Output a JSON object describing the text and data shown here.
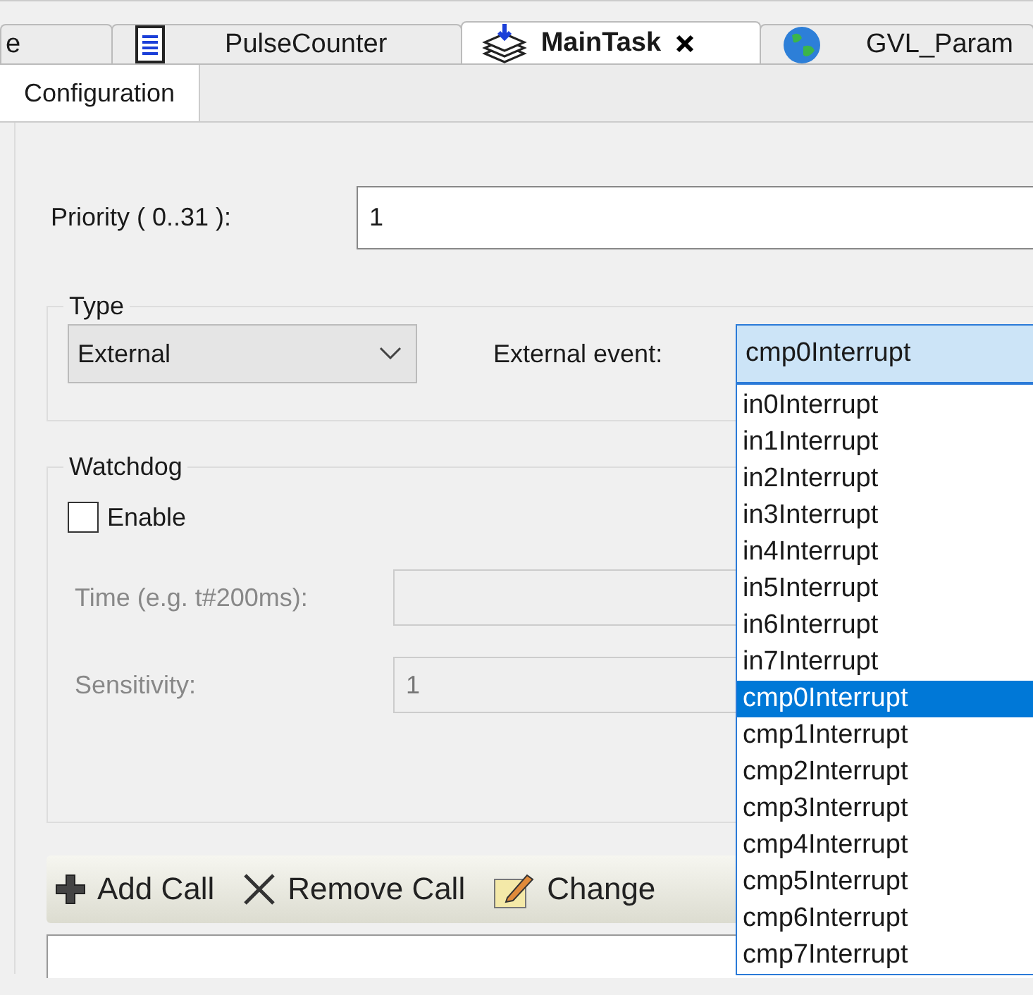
{
  "document_tabs": [
    {
      "label": "e",
      "kind": "plain",
      "selected": false
    },
    {
      "label": "PulseCounter",
      "kind": "document",
      "selected": false
    },
    {
      "label": "MainTask",
      "kind": "task",
      "selected": true
    },
    {
      "label": "GVL_Param",
      "kind": "globe",
      "selected": false
    }
  ],
  "editor_tabs": [
    {
      "label": "Configuration",
      "selected": true
    }
  ],
  "priority": {
    "label": "Priority ( 0..31 ):",
    "value": "1"
  },
  "type_group": {
    "title": "Type",
    "type_select": {
      "value": "External"
    },
    "event_label": "External event:",
    "event_select": {
      "value": "cmp0Interrupt",
      "expanded": true,
      "options": [
        {
          "label": "in0Interrupt",
          "selected": false
        },
        {
          "label": "in1Interrupt",
          "selected": false
        },
        {
          "label": "in2Interrupt",
          "selected": false
        },
        {
          "label": "in3Interrupt",
          "selected": false
        },
        {
          "label": "in4Interrupt",
          "selected": false
        },
        {
          "label": "in5Interrupt",
          "selected": false
        },
        {
          "label": "in6Interrupt",
          "selected": false
        },
        {
          "label": "in7Interrupt",
          "selected": false
        },
        {
          "label": "cmp0Interrupt",
          "selected": true
        },
        {
          "label": "cmp1Interrupt",
          "selected": false
        },
        {
          "label": "cmp2Interrupt",
          "selected": false
        },
        {
          "label": "cmp3Interrupt",
          "selected": false
        },
        {
          "label": "cmp4Interrupt",
          "selected": false
        },
        {
          "label": "cmp5Interrupt",
          "selected": false
        },
        {
          "label": "cmp6Interrupt",
          "selected": false
        },
        {
          "label": "cmp7Interrupt",
          "selected": false
        }
      ]
    }
  },
  "watchdog": {
    "title": "Watchdog",
    "enable": {
      "label": "Enable",
      "checked": false
    },
    "fields": [
      {
        "label": "Time (e.g. t#200ms):",
        "disabled": true
      },
      {
        "label": "Sensitivity:",
        "value": "1",
        "disabled": true
      }
    ]
  },
  "call_toolbar": [
    {
      "label": "Add Call",
      "kind": "plus"
    },
    {
      "label": "Remove Call",
      "kind": "cross"
    },
    {
      "label": "Change",
      "kind": "pencil"
    }
  ]
}
